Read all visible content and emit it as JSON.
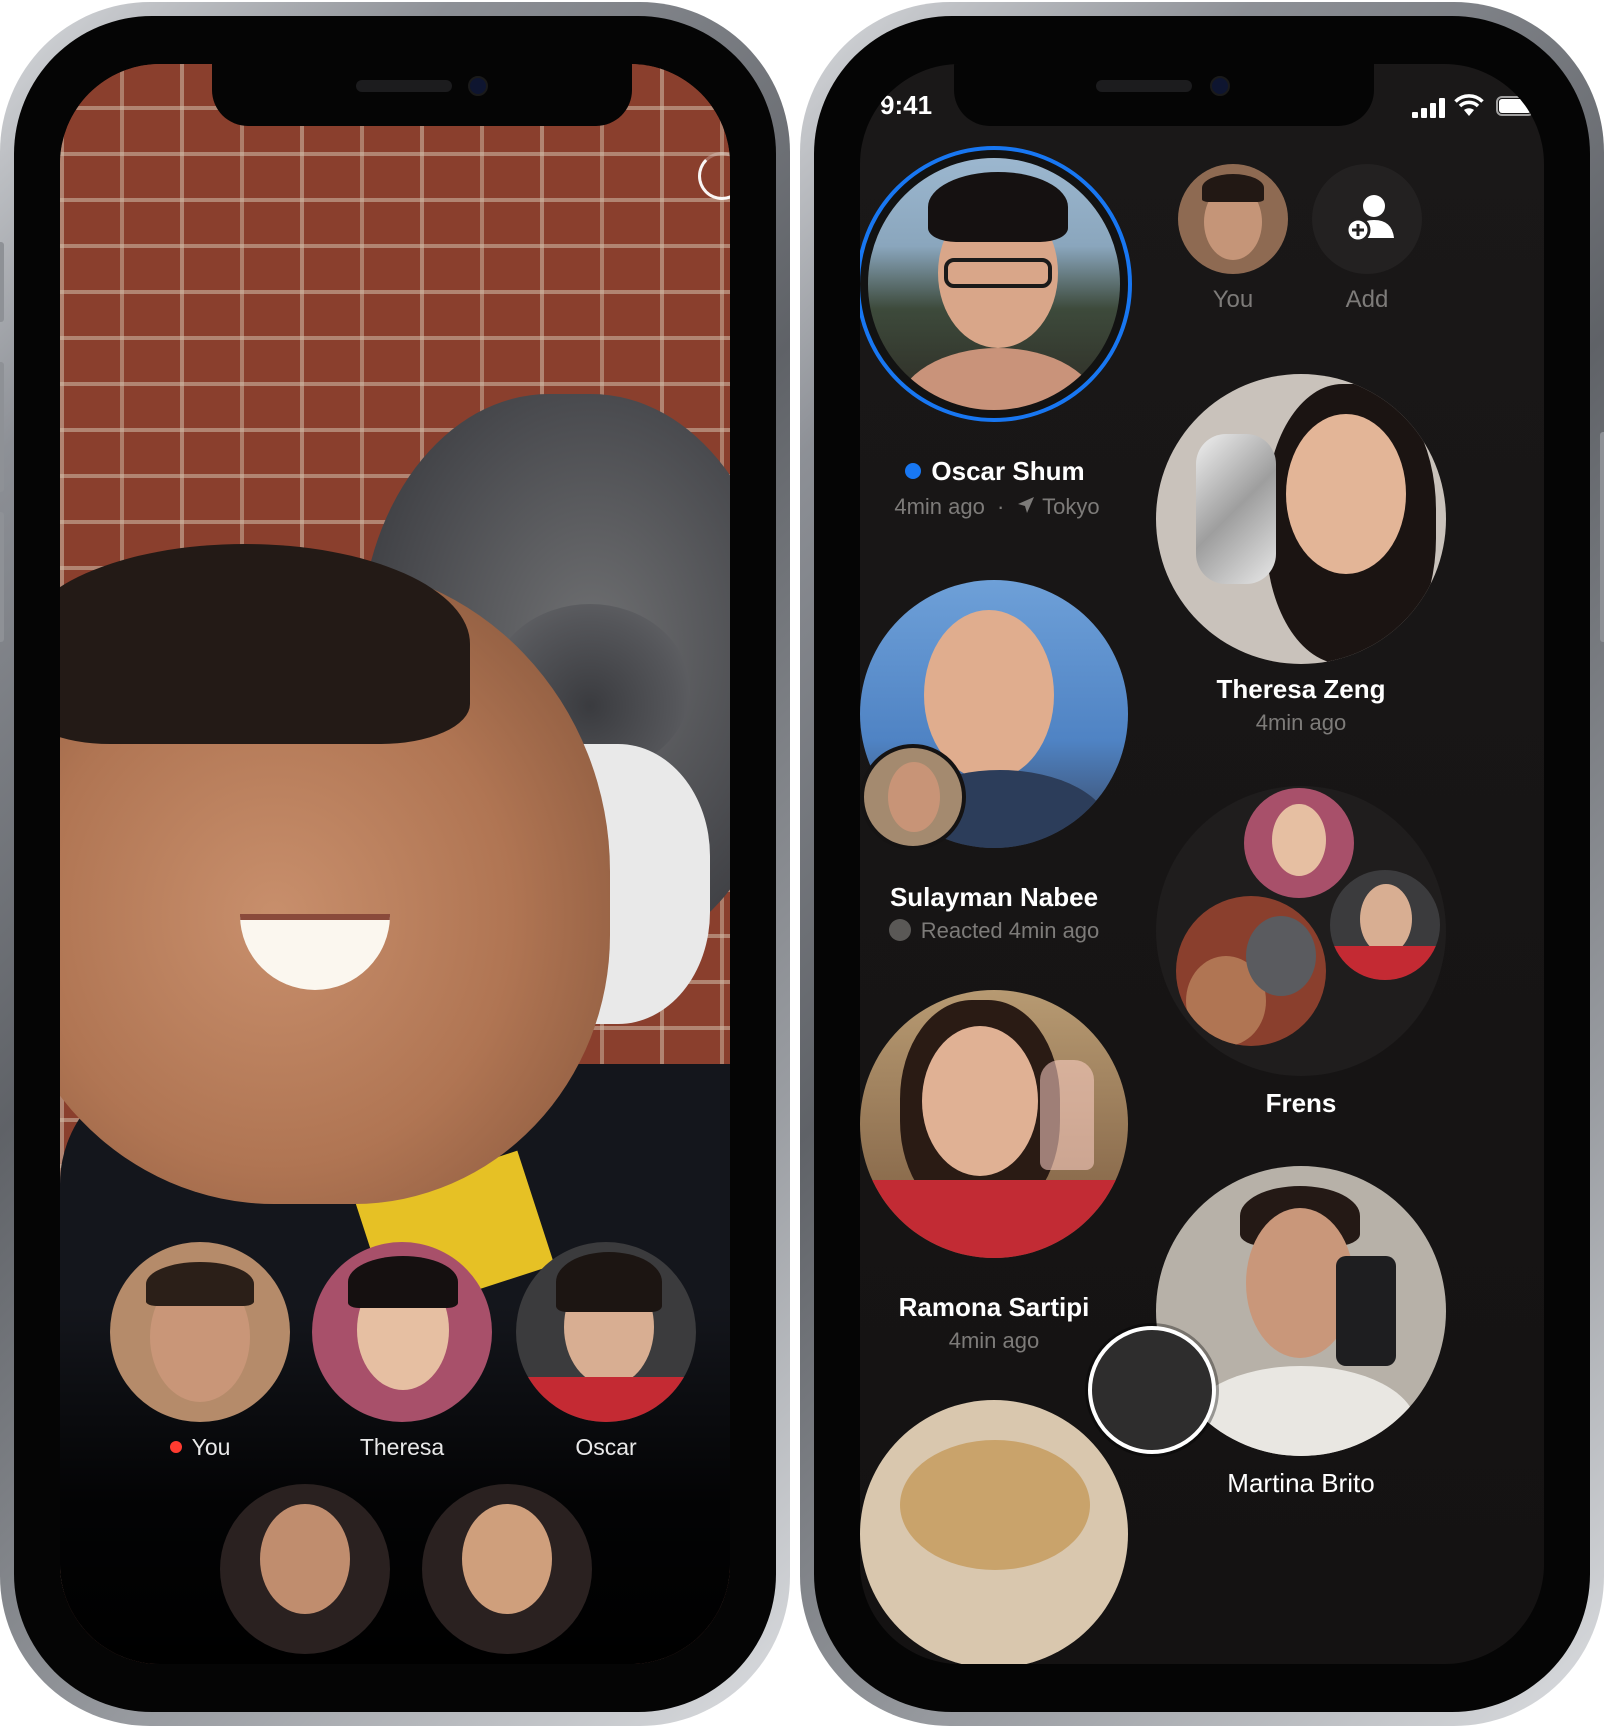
{
  "right_screen": {
    "status_bar": {
      "time": "9:41"
    },
    "top_row": {
      "you_label": "You",
      "add_label": "Add"
    },
    "contacts": [
      {
        "name": "Oscar Shum",
        "subtitle_time": "4min ago",
        "subtitle_separator": "·",
        "subtitle_location": "Tokyo",
        "online": true
      },
      {
        "name": "Theresa Zeng",
        "subtitle": "4min ago"
      },
      {
        "name": "Sulayman Nabee",
        "subtitle": "Reacted 4min ago"
      },
      {
        "name": "Frens",
        "subtitle": ""
      },
      {
        "name": "Ramona Sartipi",
        "subtitle": "4min ago"
      },
      {
        "name": "Martina Brito",
        "subtitle": ""
      }
    ]
  },
  "left_screen": {
    "participants": [
      {
        "label": "You",
        "recording": true
      },
      {
        "label": "Theresa",
        "recording": false
      },
      {
        "label": "Oscar",
        "recording": false
      }
    ]
  },
  "colors": {
    "accent_blue": "#1877f2",
    "record_red": "#ff3b30",
    "background_dark": "#151313"
  }
}
